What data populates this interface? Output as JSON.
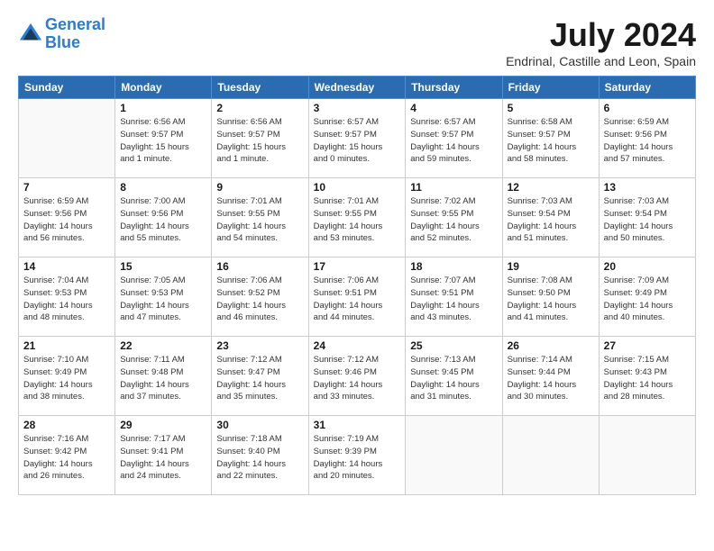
{
  "logo": {
    "line1": "General",
    "line2": "Blue"
  },
  "title": "July 2024",
  "subtitle": "Endrinal, Castille and Leon, Spain",
  "header_days": [
    "Sunday",
    "Monday",
    "Tuesday",
    "Wednesday",
    "Thursday",
    "Friday",
    "Saturday"
  ],
  "weeks": [
    [
      {
        "day": "",
        "info": ""
      },
      {
        "day": "1",
        "info": "Sunrise: 6:56 AM\nSunset: 9:57 PM\nDaylight: 15 hours\nand 1 minute."
      },
      {
        "day": "2",
        "info": "Sunrise: 6:56 AM\nSunset: 9:57 PM\nDaylight: 15 hours\nand 1 minute."
      },
      {
        "day": "3",
        "info": "Sunrise: 6:57 AM\nSunset: 9:57 PM\nDaylight: 15 hours\nand 0 minutes."
      },
      {
        "day": "4",
        "info": "Sunrise: 6:57 AM\nSunset: 9:57 PM\nDaylight: 14 hours\nand 59 minutes."
      },
      {
        "day": "5",
        "info": "Sunrise: 6:58 AM\nSunset: 9:57 PM\nDaylight: 14 hours\nand 58 minutes."
      },
      {
        "day": "6",
        "info": "Sunrise: 6:59 AM\nSunset: 9:56 PM\nDaylight: 14 hours\nand 57 minutes."
      }
    ],
    [
      {
        "day": "7",
        "info": "Sunrise: 6:59 AM\nSunset: 9:56 PM\nDaylight: 14 hours\nand 56 minutes."
      },
      {
        "day": "8",
        "info": "Sunrise: 7:00 AM\nSunset: 9:56 PM\nDaylight: 14 hours\nand 55 minutes."
      },
      {
        "day": "9",
        "info": "Sunrise: 7:01 AM\nSunset: 9:55 PM\nDaylight: 14 hours\nand 54 minutes."
      },
      {
        "day": "10",
        "info": "Sunrise: 7:01 AM\nSunset: 9:55 PM\nDaylight: 14 hours\nand 53 minutes."
      },
      {
        "day": "11",
        "info": "Sunrise: 7:02 AM\nSunset: 9:55 PM\nDaylight: 14 hours\nand 52 minutes."
      },
      {
        "day": "12",
        "info": "Sunrise: 7:03 AM\nSunset: 9:54 PM\nDaylight: 14 hours\nand 51 minutes."
      },
      {
        "day": "13",
        "info": "Sunrise: 7:03 AM\nSunset: 9:54 PM\nDaylight: 14 hours\nand 50 minutes."
      }
    ],
    [
      {
        "day": "14",
        "info": "Sunrise: 7:04 AM\nSunset: 9:53 PM\nDaylight: 14 hours\nand 48 minutes."
      },
      {
        "day": "15",
        "info": "Sunrise: 7:05 AM\nSunset: 9:53 PM\nDaylight: 14 hours\nand 47 minutes."
      },
      {
        "day": "16",
        "info": "Sunrise: 7:06 AM\nSunset: 9:52 PM\nDaylight: 14 hours\nand 46 minutes."
      },
      {
        "day": "17",
        "info": "Sunrise: 7:06 AM\nSunset: 9:51 PM\nDaylight: 14 hours\nand 44 minutes."
      },
      {
        "day": "18",
        "info": "Sunrise: 7:07 AM\nSunset: 9:51 PM\nDaylight: 14 hours\nand 43 minutes."
      },
      {
        "day": "19",
        "info": "Sunrise: 7:08 AM\nSunset: 9:50 PM\nDaylight: 14 hours\nand 41 minutes."
      },
      {
        "day": "20",
        "info": "Sunrise: 7:09 AM\nSunset: 9:49 PM\nDaylight: 14 hours\nand 40 minutes."
      }
    ],
    [
      {
        "day": "21",
        "info": "Sunrise: 7:10 AM\nSunset: 9:49 PM\nDaylight: 14 hours\nand 38 minutes."
      },
      {
        "day": "22",
        "info": "Sunrise: 7:11 AM\nSunset: 9:48 PM\nDaylight: 14 hours\nand 37 minutes."
      },
      {
        "day": "23",
        "info": "Sunrise: 7:12 AM\nSunset: 9:47 PM\nDaylight: 14 hours\nand 35 minutes."
      },
      {
        "day": "24",
        "info": "Sunrise: 7:12 AM\nSunset: 9:46 PM\nDaylight: 14 hours\nand 33 minutes."
      },
      {
        "day": "25",
        "info": "Sunrise: 7:13 AM\nSunset: 9:45 PM\nDaylight: 14 hours\nand 31 minutes."
      },
      {
        "day": "26",
        "info": "Sunrise: 7:14 AM\nSunset: 9:44 PM\nDaylight: 14 hours\nand 30 minutes."
      },
      {
        "day": "27",
        "info": "Sunrise: 7:15 AM\nSunset: 9:43 PM\nDaylight: 14 hours\nand 28 minutes."
      }
    ],
    [
      {
        "day": "28",
        "info": "Sunrise: 7:16 AM\nSunset: 9:42 PM\nDaylight: 14 hours\nand 26 minutes."
      },
      {
        "day": "29",
        "info": "Sunrise: 7:17 AM\nSunset: 9:41 PM\nDaylight: 14 hours\nand 24 minutes."
      },
      {
        "day": "30",
        "info": "Sunrise: 7:18 AM\nSunset: 9:40 PM\nDaylight: 14 hours\nand 22 minutes."
      },
      {
        "day": "31",
        "info": "Sunrise: 7:19 AM\nSunset: 9:39 PM\nDaylight: 14 hours\nand 20 minutes."
      },
      {
        "day": "",
        "info": ""
      },
      {
        "day": "",
        "info": ""
      },
      {
        "day": "",
        "info": ""
      }
    ]
  ]
}
